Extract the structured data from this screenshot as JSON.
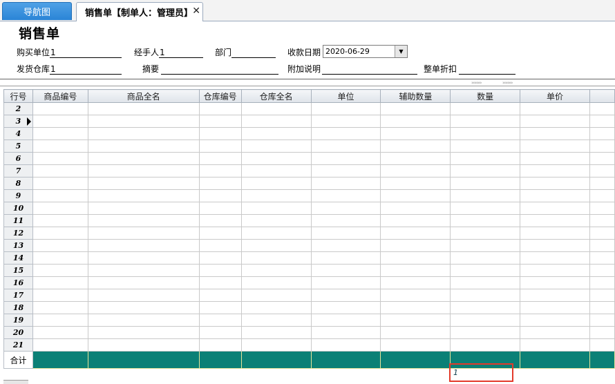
{
  "tabs": {
    "nav": "导航图",
    "active": "销售单【制单人：管理员】",
    "close_icon": "close-icon"
  },
  "form": {
    "title": "销售单",
    "buyer_label": "购买单位",
    "buyer_value": "1",
    "handler_label": "经手人",
    "handler_value": "1",
    "dept_label": "部门",
    "dept_value": "",
    "date_label": "收款日期",
    "date_value": "2020-06-29",
    "warehouse_label": "发货仓库",
    "warehouse_value": "1",
    "summary_label": "摘要",
    "summary_value": "",
    "remark_label": "附加说明",
    "remark_value": "",
    "discount_label": "整单折扣",
    "discount_value": ""
  },
  "grid": {
    "columns": [
      "行号",
      "商品编号",
      "商品全名",
      "仓库编号",
      "仓库全名",
      "单位",
      "辅助数量",
      "数量",
      "单价",
      ""
    ],
    "row_numbers": [
      "2",
      "3",
      "4",
      "5",
      "6",
      "7",
      "8",
      "9",
      "10",
      "11",
      "12",
      "13",
      "14",
      "15",
      "16",
      "17",
      "18",
      "19",
      "20",
      "21"
    ],
    "current_row": "3",
    "total_label": "合计",
    "total_quantity": "1"
  },
  "colors": {
    "accent": "#2a84d6",
    "total_row": "#0b8076",
    "highlight": "#e33a2a"
  }
}
